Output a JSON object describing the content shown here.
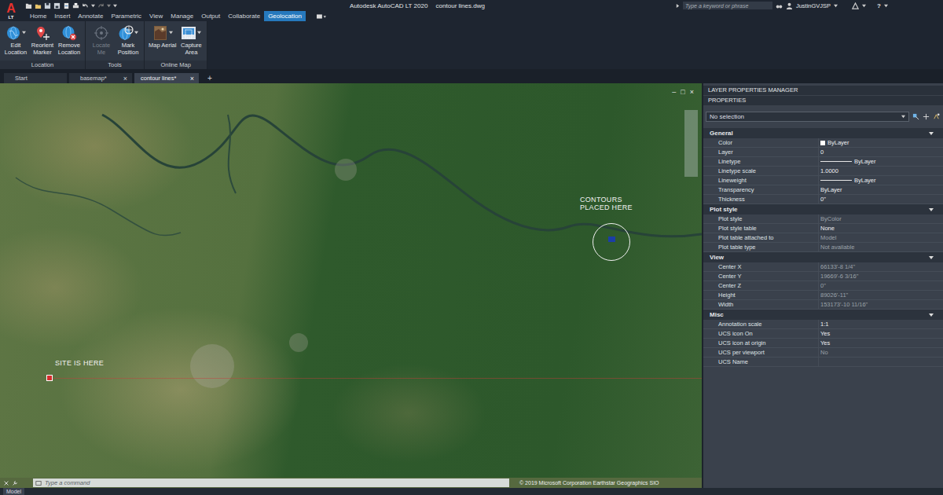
{
  "app": {
    "logo": "A",
    "logo_sub": "LT",
    "title": "Autodesk AutoCAD LT 2020",
    "file": "contour lines.dwg"
  },
  "search": {
    "placeholder": "Type a keyword or phrase"
  },
  "user": {
    "name": "JustinGVJSP"
  },
  "help": "?",
  "ribbon_tabs": [
    {
      "label": "Home",
      "selected": false
    },
    {
      "label": "Insert",
      "selected": false
    },
    {
      "label": "Annotate",
      "selected": false
    },
    {
      "label": "Parametric",
      "selected": false
    },
    {
      "label": "View",
      "selected": false
    },
    {
      "label": "Manage",
      "selected": false
    },
    {
      "label": "Output",
      "selected": false
    },
    {
      "label": "Collaborate",
      "selected": false
    },
    {
      "label": "Geolocation",
      "selected": true
    }
  ],
  "ribbon": {
    "groups": [
      {
        "label": "Location",
        "buttons": [
          {
            "lines": [
              "Edit",
              "Location"
            ],
            "disabled": false,
            "dropdown": true
          },
          {
            "lines": [
              "Reorient",
              "Marker"
            ],
            "disabled": false,
            "dropdown": false
          },
          {
            "lines": [
              "Remove",
              "Location"
            ],
            "disabled": false,
            "dropdown": false
          }
        ]
      },
      {
        "label": "Tools",
        "buttons": [
          {
            "lines": [
              "Locate",
              "Me"
            ],
            "disabled": true,
            "dropdown": false
          },
          {
            "lines": [
              "Mark",
              "Position"
            ],
            "disabled": false,
            "dropdown": true
          }
        ]
      },
      {
        "label": "Online Map",
        "buttons": [
          {
            "lines": [
              "Map Aerial"
            ],
            "disabled": false,
            "dropdown": true
          },
          {
            "lines": [
              "Capture",
              "Area"
            ],
            "disabled": false,
            "dropdown": true
          }
        ]
      }
    ]
  },
  "file_tabs": [
    {
      "label": "Start",
      "selected": false,
      "closable": false
    },
    {
      "label": "basemap*",
      "selected": false,
      "closable": true
    },
    {
      "label": "contour lines*",
      "selected": true,
      "closable": true
    }
  ],
  "file_tab_close": "×",
  "new_tab": "+",
  "map": {
    "annotations": [
      {
        "lines": [
          "CONTOURS",
          "PLACED HERE"
        ]
      },
      {
        "lines": [
          "SITE IS HERE"
        ]
      }
    ],
    "viewport_controls": [
      "–",
      "□",
      "×"
    ],
    "copyright": "© 2019 Microsoft Corporation Earthstar Geographics SIO"
  },
  "command_line": {
    "placeholder": "Type a command"
  },
  "status_bar": {
    "tabs": [
      {
        "label": "Model",
        "selected": true
      }
    ]
  },
  "palette": {
    "titles": [
      "LAYER PROPERTIES MANAGER",
      "PROPERTIES"
    ],
    "selection": "No selection",
    "sections": [
      {
        "title": "General",
        "expanded": true,
        "rows": [
          {
            "label": "Color",
            "value": "ByLayer",
            "kind": "swatch",
            "disabled": false
          },
          {
            "label": "Layer",
            "value": "0",
            "kind": "text",
            "disabled": false
          },
          {
            "label": "Linetype",
            "value": "ByLayer",
            "kind": "line",
            "disabled": false
          },
          {
            "label": "Linetype scale",
            "value": "1.0000",
            "kind": "text",
            "disabled": false
          },
          {
            "label": "Lineweight",
            "value": "ByLayer",
            "kind": "line",
            "disabled": false
          },
          {
            "label": "Transparency",
            "value": "ByLayer",
            "kind": "text",
            "disabled": false
          },
          {
            "label": "Thickness",
            "value": "0\"",
            "kind": "text",
            "disabled": false
          }
        ]
      },
      {
        "title": "Plot style",
        "expanded": true,
        "rows": [
          {
            "label": "Plot style",
            "value": "ByColor",
            "kind": "text",
            "disabled": true
          },
          {
            "label": "Plot style table",
            "value": "None",
            "kind": "text",
            "disabled": false
          },
          {
            "label": "Plot table attached to",
            "value": "Model",
            "kind": "text",
            "disabled": true
          },
          {
            "label": "Plot table type",
            "value": "Not available",
            "kind": "text",
            "disabled": true
          }
        ]
      },
      {
        "title": "View",
        "expanded": true,
        "rows": [
          {
            "label": "Center X",
            "value": "66133'-8 1/4\"",
            "kind": "text",
            "disabled": true
          },
          {
            "label": "Center Y",
            "value": "19669'-6 3/16\"",
            "kind": "text",
            "disabled": true
          },
          {
            "label": "Center Z",
            "value": "0\"",
            "kind": "text",
            "disabled": true
          },
          {
            "label": "Height",
            "value": "89026'-11\"",
            "kind": "text",
            "disabled": true
          },
          {
            "label": "Width",
            "value": "153173'-10 11/16\"",
            "kind": "text",
            "disabled": true
          }
        ]
      },
      {
        "title": "Misc",
        "expanded": true,
        "rows": [
          {
            "label": "Annotation scale",
            "value": "1:1",
            "kind": "text",
            "disabled": false
          },
          {
            "label": "UCS icon On",
            "value": "Yes",
            "kind": "text",
            "disabled": false
          },
          {
            "label": "UCS icon at origin",
            "value": "Yes",
            "kind": "text",
            "disabled": false
          },
          {
            "label": "UCS per viewport",
            "value": "No",
            "kind": "text",
            "disabled": true
          },
          {
            "label": "UCS Name",
            "value": "",
            "kind": "text",
            "disabled": false
          }
        ]
      }
    ]
  }
}
